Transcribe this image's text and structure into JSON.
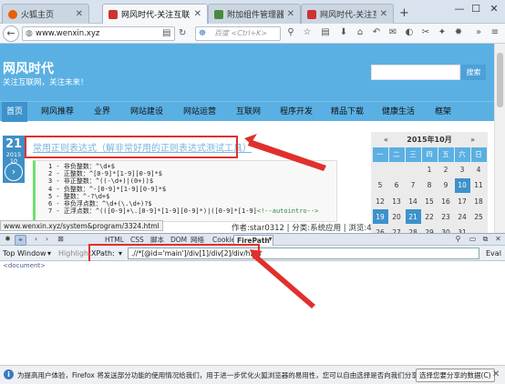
{
  "browser": {
    "tabs": [
      {
        "label": "火狐主页",
        "favicon_color": "#e66000",
        "active": false
      },
      {
        "label": "网风时代-关注互联网，关...",
        "favicon_color": "#cc3333",
        "active": true
      },
      {
        "label": "附加组件管理器",
        "favicon_color": "#4a8a3c",
        "active": false
      },
      {
        "label": "网风时代-关注互联网，关...",
        "favicon_color": "#cc3333",
        "active": false
      }
    ],
    "new_tab": "+",
    "window_controls": [
      "—",
      "☐",
      "✕"
    ],
    "url": "www.wenxin.xyz",
    "search_engine_placeholder": "百度 <Ctrl+K>"
  },
  "site": {
    "title": "网风时代",
    "slogan": "关注互联网，关注未来！",
    "search_button": "搜索",
    "menu": [
      "首页",
      "网风推荐",
      "业界",
      "网站建设",
      "网站运营",
      "互联网",
      "程序开发",
      "精品下载",
      "健康生活",
      "框架"
    ],
    "active_menu_index": 0
  },
  "post": {
    "day": "21",
    "year": "2015",
    "month": "10",
    "title": "常用正则表达式（解非常好用的正则表达式测试工具）",
    "code_lines": [
      "1 - 非负整数：^\\d+$",
      "2 - 正整数：^[0-9]*[1-9][0-9]*$",
      "3 - 非正整数：^((-\\d+)|(0+))$",
      "4 - 负整数：^-[0-9]*[1-9][0-9]*$",
      "5 - 整数：^-?\\d+$",
      "6 - 非负浮点数：^\\d+(\\.\\d+)?$",
      "7 - 正浮点数：^(([0-9]+\\.[0-9]*[1-9][0-9]*)|([0-9]*[1-9]"
    ],
    "code_comment": "<!--autointro-->",
    "meta": "作者:star0312 | 分类:系统应用 | 浏览:4 | 评论:0"
  },
  "status_url": "www.wenxin.xyz/system&program/3324.html",
  "calendar": {
    "prev": "«",
    "month_label": "2015年10月",
    "next": "»",
    "weekdays": [
      "一",
      "二",
      "三",
      "四",
      "五",
      "六",
      "日"
    ],
    "days": [
      "",
      "",
      "",
      "1",
      "2",
      "3",
      "4",
      "5",
      "6",
      "7",
      "8",
      "9",
      "10",
      "11",
      "12",
      "13",
      "14",
      "15",
      "16",
      "17",
      "18",
      "19",
      "20",
      "21",
      "22",
      "23",
      "24",
      "25",
      "26",
      "27",
      "28",
      "29",
      "30",
      "31",
      ""
    ],
    "highlight_days": [
      "10",
      "19",
      "21"
    ]
  },
  "firebug": {
    "tabs": [
      "HTML",
      "CSS",
      "脚本",
      "DOM",
      "网络",
      "Cookies",
      "FirePath"
    ],
    "active_tab": "FirePath",
    "window_select": "Top Window",
    "highlight_label": "Highlight",
    "xpath_label": "XPath:",
    "xpath_value": ".//*[@id='main']/div[1]/div[2]/div/h2/a",
    "eval_label": "Eval",
    "doc_node": "<document>"
  },
  "notification": {
    "message": "为提高用户体验，Firefox 将发送部分功能的使用情况给我们，用于进一步优化火狐浏览器的易用性，您可以自由选择是否向我们分享数据。",
    "button": "选择您要分享的数据(C)",
    "close": "✕"
  },
  "colors": {
    "site_blue": "#5ab0e3",
    "annotation_red": "#e0302e"
  }
}
